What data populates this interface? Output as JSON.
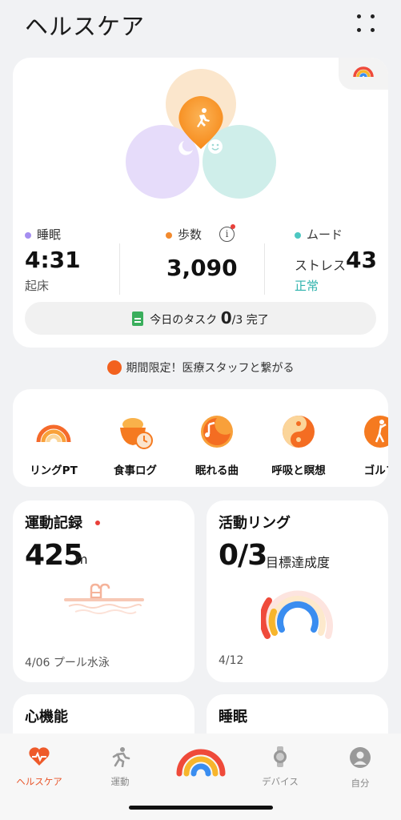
{
  "header": {
    "title": "ヘルスケア"
  },
  "summary": {
    "sleep": {
      "label": "睡眠",
      "value": "4:31",
      "sub": "起床",
      "color": "#a58ef0"
    },
    "steps": {
      "label": "歩数",
      "value": "3,090",
      "info": "i",
      "color": "#f28a2e"
    },
    "mood": {
      "label": "ムード",
      "stress_label": "ストレス",
      "value": "43",
      "status": "正常",
      "color": "#4cc7c1"
    },
    "task": {
      "prefix": "今日のタスク",
      "done": "0",
      "total": "/3",
      "suffix": "完了"
    }
  },
  "promo": {
    "text": "期間限定！医療スタッフと繋がる"
  },
  "shortcuts": [
    {
      "label": "リングPT",
      "icon": "ring-pt-icon"
    },
    {
      "label": "食事ログ",
      "icon": "meal-log-icon"
    },
    {
      "label": "眠れる曲",
      "icon": "sleep-music-icon"
    },
    {
      "label": "呼吸と瞑想",
      "icon": "breathing-icon"
    },
    {
      "label": "ゴルフ",
      "icon": "golf-icon"
    }
  ],
  "exercise": {
    "title": "運動記録",
    "value": "425",
    "unit": "m",
    "date": "4/06 プール水泳"
  },
  "activity": {
    "title": "活動リング",
    "value": "0/3",
    "sub": "目標達成度",
    "date": "4/12"
  },
  "heart": {
    "title": "心機能"
  },
  "sleep_card": {
    "title": "睡眠"
  },
  "tabs": [
    {
      "label": "ヘルスケア",
      "icon": "heart-icon",
      "active": true
    },
    {
      "label": "運動",
      "icon": "runner-icon"
    },
    {
      "label": "",
      "icon": "rainbow-ring-icon"
    },
    {
      "label": "デバイス",
      "icon": "watch-icon"
    },
    {
      "label": "自分",
      "icon": "profile-icon"
    }
  ]
}
